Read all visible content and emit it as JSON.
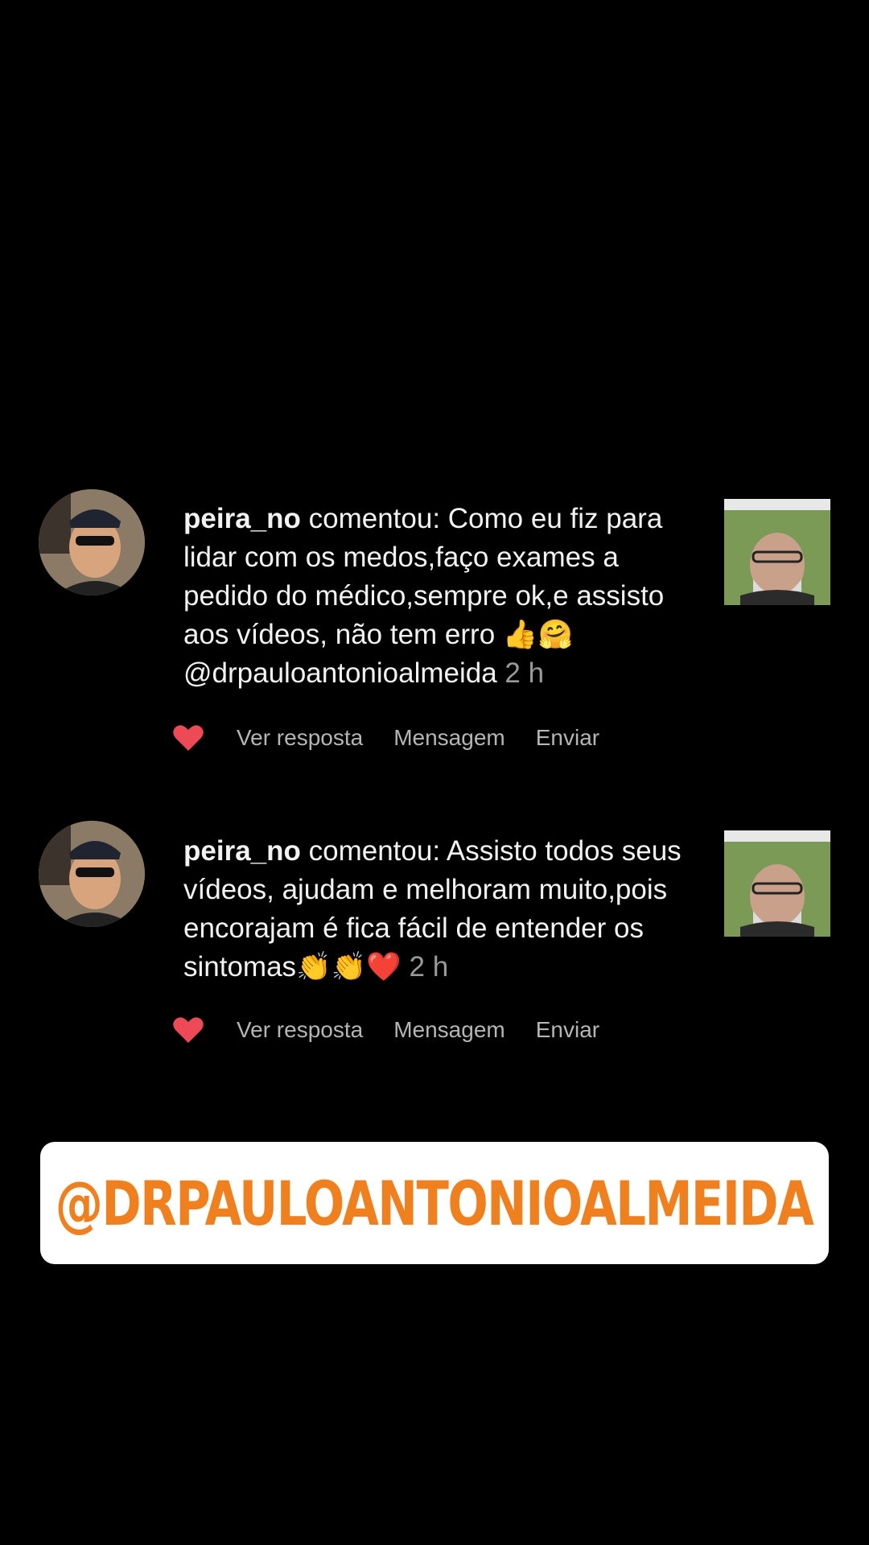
{
  "comments": [
    {
      "username": "peira_no",
      "action": " comentou: ",
      "text": "Como eu fiz para lidar com os medos,faço exames a pedido do médico,sempre ok,e assisto aos vídeos, não tem erro 👍🤗 @drpauloantonioalmeida",
      "time": "2 h",
      "liked": true
    },
    {
      "username": "peira_no",
      "action": " comentou: ",
      "text": "Assisto todos seus vídeos, ajudam e melhoram muito,pois encorajam é fica fácil de entender os sintomas👏👏❤️",
      "time": "2 h",
      "liked": true
    }
  ],
  "actions": {
    "reply": "Ver resposta",
    "message": "Mensagem",
    "send": "Enviar"
  },
  "banner": {
    "text": "@DRPAULOANTONIOALMEIDA",
    "color": "#f07f1e"
  },
  "colors": {
    "background": "#000000",
    "heart": "#ed4956",
    "muted": "#9a9a9a"
  }
}
